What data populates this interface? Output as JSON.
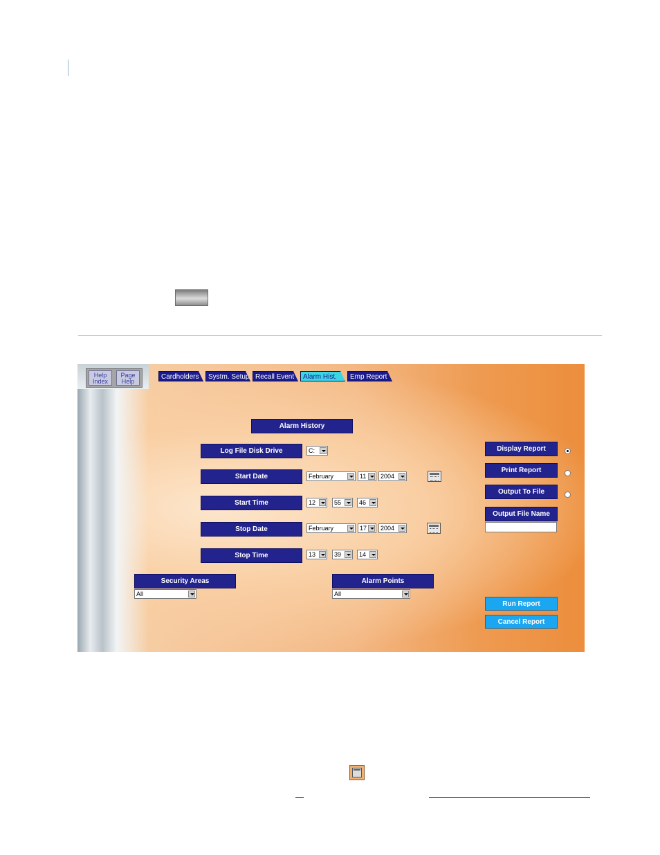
{
  "help": {
    "index_label": "Help Index",
    "page_label": "Page Help"
  },
  "tabs": [
    {
      "label": "Cardholders",
      "active": false
    },
    {
      "label": "Systm. Setup",
      "active": false
    },
    {
      "label": "Recall Event",
      "active": false
    },
    {
      "label": "Alarm Hist.",
      "active": true
    },
    {
      "label": "Emp Report",
      "active": false
    }
  ],
  "form": {
    "title": "Alarm History",
    "log_drive": {
      "label": "Log File Disk Drive",
      "value": "C:"
    },
    "start_date": {
      "label": "Start Date",
      "month": "February",
      "day": "11",
      "year": "2004"
    },
    "start_time": {
      "label": "Start Time",
      "hour": "12",
      "minute": "55",
      "second": "46"
    },
    "stop_date": {
      "label": "Stop Date",
      "month": "February",
      "day": "17",
      "year": "2004"
    },
    "stop_time": {
      "label": "Stop Time",
      "hour": "13",
      "minute": "39",
      "second": "14"
    },
    "security_areas": {
      "label": "Security Areas",
      "value": "All"
    },
    "alarm_points": {
      "label": "Alarm Points",
      "value": "All"
    }
  },
  "output": {
    "display_report": "Display Report",
    "print_report": "Print Report",
    "output_to_file": "Output To File",
    "selected": "display_report",
    "file_name_label": "Output File Name",
    "file_name_value": ""
  },
  "actions": {
    "run": "Run Report",
    "cancel": "Cancel Report"
  },
  "colors": {
    "label_bg": "#23238e",
    "tab_bg": "#1a1a8c",
    "tab_active": "#3ad6e4",
    "button_cyan": "#1aa6f0",
    "panel_orange": "#ec8e3c"
  },
  "icons": [
    "calendar-icon",
    "report-icon"
  ]
}
